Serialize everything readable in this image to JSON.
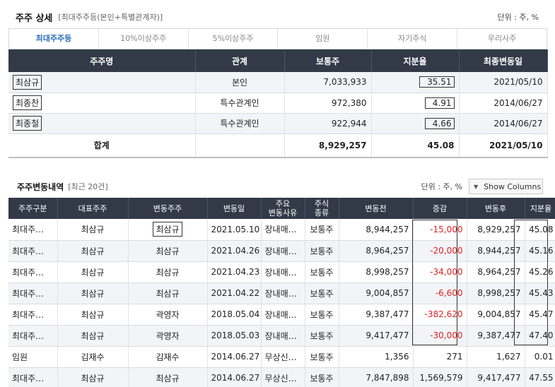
{
  "section1": {
    "title": "주주 상세",
    "subtitle": "[최대주주등(본인+특별관계자)]",
    "unit": "단위 : 주, %",
    "tabs": [
      "최대주주등",
      "10%이상주주",
      "5%이상주주",
      "임원",
      "자기주식",
      "우리사주"
    ],
    "columns": [
      "주주명",
      "관계",
      "보통주",
      "지분율",
      "최종변동일"
    ],
    "rows": [
      {
        "name": "최삼규",
        "relation": "본인",
        "common": "7,033,933",
        "ratio": "35.51",
        "date": "2021/05/10"
      },
      {
        "name": "최종찬",
        "relation": "특수관계인",
        "common": "972,380",
        "ratio": "4.91",
        "date": "2014/06/27"
      },
      {
        "name": "최종철",
        "relation": "특수관계인",
        "common": "922,944",
        "ratio": "4.66",
        "date": "2014/06/27"
      }
    ],
    "total": {
      "label": "합계",
      "common": "8,929,257",
      "ratio": "45.08",
      "date": "2021/05/10"
    }
  },
  "section2": {
    "title": "주주변동내역",
    "subtitle": "[최근 20건]",
    "unit": "단위 : 주, %",
    "show_columns": "Show Columns",
    "columns": [
      "주주구분",
      "대표주주",
      "변동주주",
      "변동일",
      "주요\n변동사유",
      "주식\n종류",
      "변동전",
      "증감",
      "변동후",
      "지분율"
    ],
    "rows": [
      {
        "type": "최대주…",
        "rep": "최삼규",
        "holder": "최삼규",
        "date": "2021.05.10",
        "reason": "장내매…",
        "kind": "보통주",
        "before": "8,944,257",
        "change": "-15,000",
        "after": "8,929,257",
        "ratio": "45.08"
      },
      {
        "type": "최대주…",
        "rep": "최삼규",
        "holder": "최삼규",
        "date": "2021.04.26",
        "reason": "장내매…",
        "kind": "보통주",
        "before": "8,964,257",
        "change": "-20,000",
        "after": "8,944,257",
        "ratio": "45.16"
      },
      {
        "type": "최대주…",
        "rep": "최삼규",
        "holder": "최삼규",
        "date": "2021.04.23",
        "reason": "장내매…",
        "kind": "보통주",
        "before": "8,998,257",
        "change": "-34,000",
        "after": "8,964,257",
        "ratio": "45.26"
      },
      {
        "type": "최대주…",
        "rep": "최삼규",
        "holder": "최삼규",
        "date": "2021.04.22",
        "reason": "장내매…",
        "kind": "보통주",
        "before": "9,004,857",
        "change": "-6,600",
        "after": "8,998,257",
        "ratio": "45.43"
      },
      {
        "type": "최대주…",
        "rep": "최삼규",
        "holder": "곽영자",
        "date": "2018.05.04",
        "reason": "장내매…",
        "kind": "보통주",
        "before": "9,387,477",
        "change": "-382,620",
        "after": "9,004,857",
        "ratio": "45.47"
      },
      {
        "type": "최대주…",
        "rep": "최삼규",
        "holder": "곽영자",
        "date": "2018.05.03",
        "reason": "장내매…",
        "kind": "보통주",
        "before": "9,417,477",
        "change": "-30,000",
        "after": "9,387,477",
        "ratio": "47.40"
      },
      {
        "type": "임원",
        "rep": "김재수",
        "holder": "김재수",
        "date": "2014.06.27",
        "reason": "무상신…",
        "kind": "보통주",
        "before": "1,356",
        "change": "271",
        "after": "1,627",
        "ratio": "0.01"
      },
      {
        "type": "최대주…",
        "rep": "최삼규",
        "holder": "최삼규",
        "date": "2014.06.27",
        "reason": "무상신…",
        "kind": "보통주",
        "before": "7,847,898",
        "change": "1,569,579",
        "after": "9,417,477",
        "ratio": "47.55"
      }
    ]
  }
}
